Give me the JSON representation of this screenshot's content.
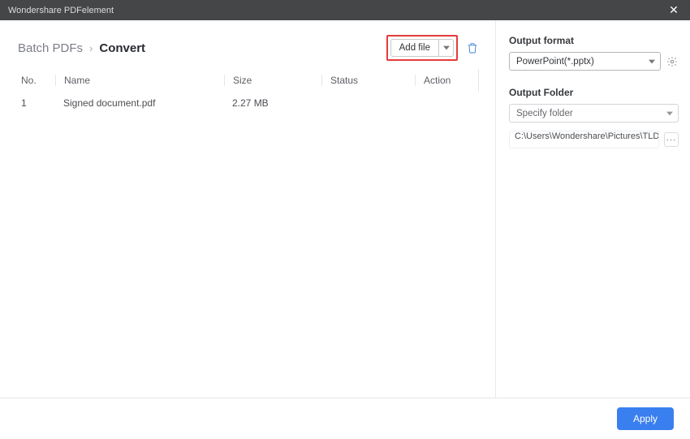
{
  "app_title": "Wondershare PDFelement",
  "breadcrumb": {
    "prev": "Batch PDFs",
    "current": "Convert"
  },
  "addfile_label": "Add file",
  "columns": {
    "no": "No.",
    "name": "Name",
    "size": "Size",
    "status": "Status",
    "action": "Action"
  },
  "rows": [
    {
      "no": "1",
      "name": "Signed document.pdf",
      "size": "2.27 MB",
      "status": "",
      "action": ""
    }
  ],
  "right": {
    "format_label": "Output format",
    "format_value": "PowerPoint(*.pptx)",
    "folder_label": "Output Folder",
    "folder_select": "Specify folder",
    "folder_path": "C:\\Users\\Wondershare\\Pictures\\TLDR T"
  },
  "apply_label": "Apply"
}
